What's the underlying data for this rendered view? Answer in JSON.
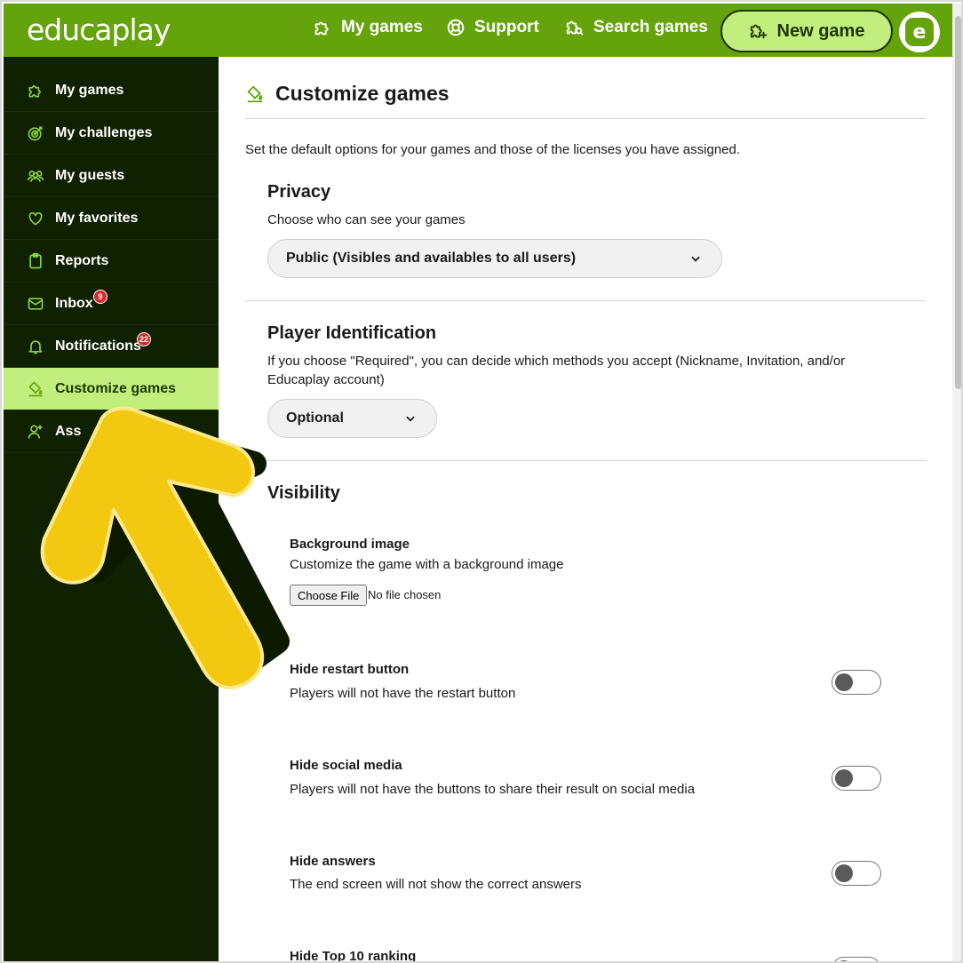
{
  "header": {
    "logo": "educaplay",
    "nav": {
      "my_games": "My games",
      "support": "Support",
      "search_games": "Search games"
    },
    "new_game": "New game",
    "avatar_letter": "e"
  },
  "sidebar": {
    "items": [
      {
        "label": "My games",
        "icon": "puzzle-icon"
      },
      {
        "label": "My challenges",
        "icon": "target-icon"
      },
      {
        "label": "My guests",
        "icon": "group-icon"
      },
      {
        "label": "My favorites",
        "icon": "heart-icon"
      },
      {
        "label": "Reports",
        "icon": "clipboard-icon"
      },
      {
        "label": "Inbox",
        "icon": "mail-icon",
        "badge": "9"
      },
      {
        "label": "Notifications",
        "icon": "bell-icon",
        "badge": "22"
      },
      {
        "label": "Customize games",
        "icon": "paint-bucket-icon",
        "active": true
      },
      {
        "label": "Ass",
        "icon": "add-user-icon"
      }
    ]
  },
  "main": {
    "title": "Customize games",
    "intro": "Set the default options for your games and those of the licenses you have assigned.",
    "privacy": {
      "title": "Privacy",
      "desc": "Choose who can see your games",
      "value": "Public (Visibles and availables to all users)"
    },
    "player_identification": {
      "title": "Player Identification",
      "desc_line1": "If you choose \"Required\", you can decide which methods you accept (Nickname, Invitation, and/or",
      "desc_line2": "Educaplay account)",
      "value": "Optional"
    },
    "visibility": {
      "title": "Visibility",
      "background_image": {
        "title": "Background image",
        "desc": "Customize the game with a background image",
        "button": "Choose File",
        "file_status": "No file chosen"
      },
      "options": [
        {
          "title": "Hide restart button",
          "desc": "Players will not have the restart button",
          "on": false
        },
        {
          "title": "Hide social media",
          "desc": "Players will not have the buttons to share their result on social media",
          "on": false
        },
        {
          "title": "Hide answers",
          "desc": "The end screen will not show the correct answers",
          "on": false
        },
        {
          "title": "Hide Top 10 ranking",
          "desc": "",
          "on": false
        }
      ]
    }
  },
  "colors": {
    "brand_green": "#65a30d",
    "sidebar_bg": "#102102",
    "active_bg": "#c1ee7c",
    "arrow_yellow": "#f2c811"
  }
}
